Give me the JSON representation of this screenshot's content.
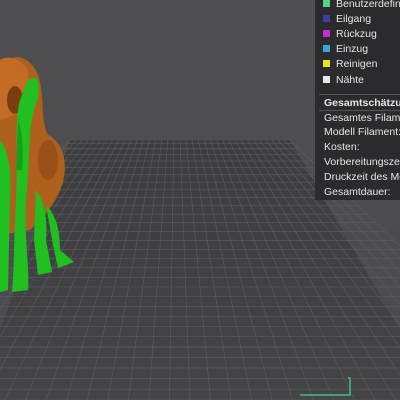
{
  "legend": {
    "items": [
      {
        "label": "Benutzerdefiniert",
        "color": "#57d38a"
      },
      {
        "label": "Eilgang",
        "color": "#3b3ea8"
      },
      {
        "label": "Rückzug",
        "color": "#c72fc6"
      },
      {
        "label": "Einzug",
        "color": "#3aa7d6"
      },
      {
        "label": "Reinigen",
        "color": "#e6e626"
      },
      {
        "label": "Nähte",
        "color": "#e8e8e8"
      }
    ]
  },
  "estimate": {
    "title": "Gesamtschätzung",
    "rows": [
      "Gesamtes Filament:",
      "Modell Filament:",
      "Kosten:",
      "Vorbereitungszeit:",
      "Druckzeit des Modells:",
      "Gesamtdauer:"
    ]
  },
  "colors": {
    "bed": "#3f3f42",
    "grid": "#5a5a5e",
    "model_orange": "#b5651f",
    "support_green": "#1fbf1f",
    "accent": "#3cc27a"
  }
}
